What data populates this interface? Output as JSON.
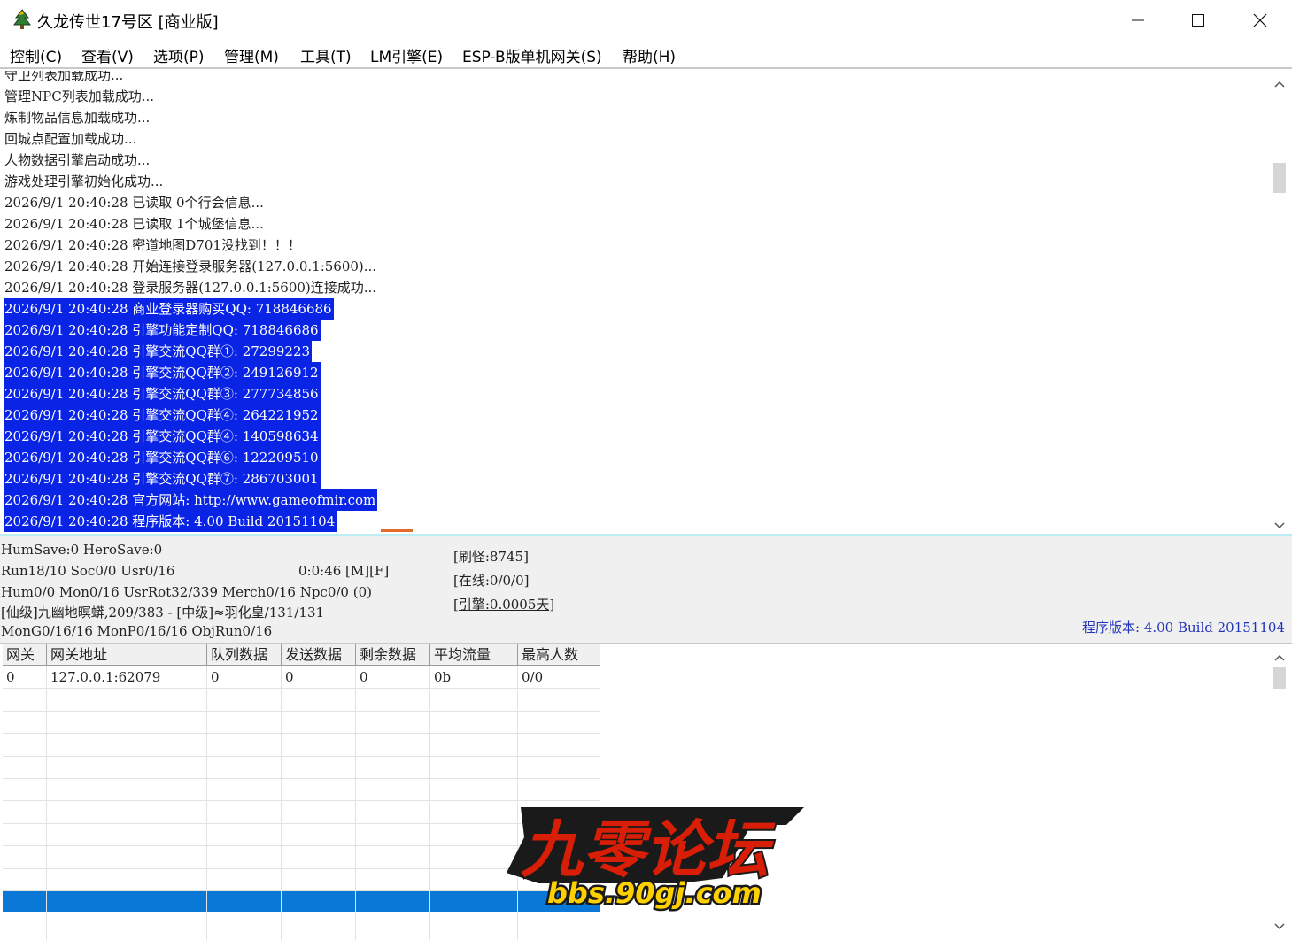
{
  "window": {
    "title": "久龙传世17号区 [商业版]",
    "icon": "tree-icon",
    "controls": [
      "minimize-icon",
      "maximize-icon",
      "close-icon"
    ]
  },
  "menu": [
    "控制(C)",
    "查看(V)",
    "选项(P)",
    "管理(M)",
    "工具(T)",
    "LM引擎(E)",
    "ESP-B版单机网关(S)",
    "帮助(H)"
  ],
  "log": {
    "lines": [
      {
        "text": "守卫列表加载成功...",
        "selected": false
      },
      {
        "text": "管理NPC列表加载成功...",
        "selected": false
      },
      {
        "text": "炼制物品信息加载成功...",
        "selected": false
      },
      {
        "text": "回城点配置加载成功...",
        "selected": false
      },
      {
        "text": "人物数据引擎启动成功...",
        "selected": false
      },
      {
        "text": "游戏处理引擎初始化成功...",
        "selected": false
      },
      {
        "text": "2026/9/1 20:40:28 已读取 0个行会信息...",
        "selected": false
      },
      {
        "text": "2026/9/1 20:40:28 已读取 1个城堡信息...",
        "selected": false
      },
      {
        "text": "2026/9/1 20:40:28 密道地图D701没找到！！！",
        "selected": false
      },
      {
        "text": "2026/9/1 20:40:28 开始连接登录服务器(127.0.0.1:5600)...",
        "selected": false
      },
      {
        "text": "2026/9/1 20:40:28 登录服务器(127.0.0.1:5600)连接成功...",
        "selected": false
      },
      {
        "text": "2026/9/1 20:40:28 商业登录器购买QQ: 718846686",
        "selected": true
      },
      {
        "text": "2026/9/1 20:40:28 引擎功能定制QQ: 718846686",
        "selected": true
      },
      {
        "text": "2026/9/1 20:40:28 引擎交流QQ群①: 27299223",
        "selected": true
      },
      {
        "text": "2026/9/1 20:40:28 引擎交流QQ群②: 249126912",
        "selected": true
      },
      {
        "text": "2026/9/1 20:40:28 引擎交流QQ群③: 277734856",
        "selected": true
      },
      {
        "text": "2026/9/1 20:40:28 引擎交流QQ群④: 264221952",
        "selected": true
      },
      {
        "text": "2026/9/1 20:40:28 引擎交流QQ群④: 140598634",
        "selected": true
      },
      {
        "text": "2026/9/1 20:40:28 引擎交流QQ群⑥: 122209510",
        "selected": true
      },
      {
        "text": "2026/9/1 20:40:28 引擎交流QQ群⑦: 286703001",
        "selected": true
      },
      {
        "text": "2026/9/1 20:40:28 官方网站: http://www.gameofmir.com",
        "selected": true
      },
      {
        "text": "2026/9/1 20:40:28 程序版本: 4.00 Build 20151104",
        "selected": true
      }
    ]
  },
  "status": {
    "line1": "HumSave:0 HeroSave:0",
    "line2": "Run18/10 Soc0/0 Usr0/16",
    "timer": "0:0:46 [M][F]",
    "line3": "Hum0/0 Mon0/16 UsrRot32/339 Merch0/16 Npc0/0 (0)",
    "line4": "[仙级]九幽地暝蟒,209/383 - [中级]≈羽化皇/131/131",
    "line5": "MonG0/16/16 MonP0/16/16 ObjRun0/16",
    "refresh": "[刷怪:8745]",
    "online": "[在线:0/0/0]",
    "engine": "[引擎:0.0005天]",
    "version": "程序版本: 4.00 Build 20151104"
  },
  "gateway_table": {
    "columns": [
      "网关",
      "网关地址",
      "队列数据",
      "发送数据",
      "剩余数据",
      "平均流量",
      "最高人数"
    ],
    "rows": [
      [
        "0",
        "127.0.0.1:62079",
        "0",
        "0",
        "0",
        "0b",
        "0/0"
      ]
    ],
    "empty_rows": 10,
    "selected_row": 10
  },
  "watermark": {
    "title": "九零论坛",
    "url": "bbs.90gj.com",
    "colors": [
      "#d81e06",
      "#ffd000",
      "#1a1a1a"
    ]
  },
  "colors": {
    "selection": "#0a24e6",
    "table_selection": "#0a78d7",
    "version_text": "#2233bb"
  }
}
